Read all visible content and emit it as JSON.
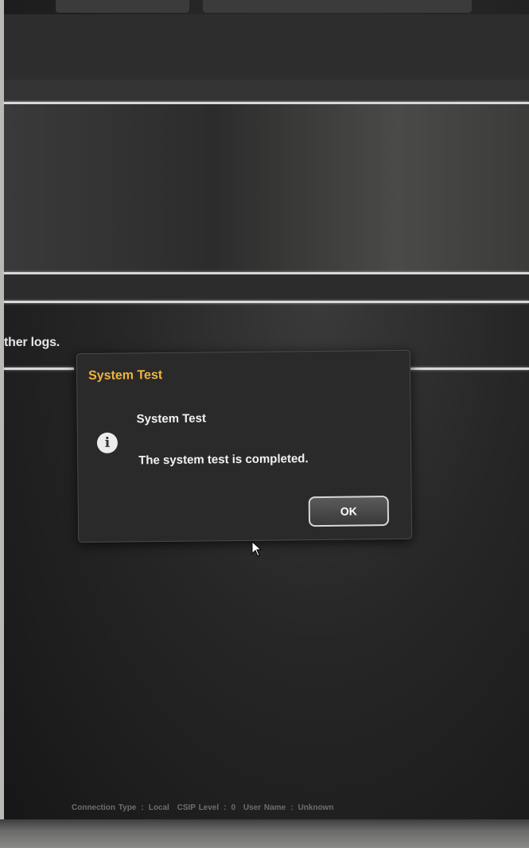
{
  "background_log_text": "ther logs.",
  "dialog": {
    "title": "System Test",
    "heading": "System Test",
    "message": "The system test is completed.",
    "icon": "info-icon",
    "ok_label": "OK",
    "title_color": "#f0b43c"
  },
  "status_bar": {
    "connection_type_label": "Connection Type",
    "connection_type_value": "Local",
    "csip_level_label": "CSIP Level",
    "csip_level_value": "0",
    "user_name_label": "User Name",
    "user_name_value": "Unknown",
    "separator": ":"
  }
}
